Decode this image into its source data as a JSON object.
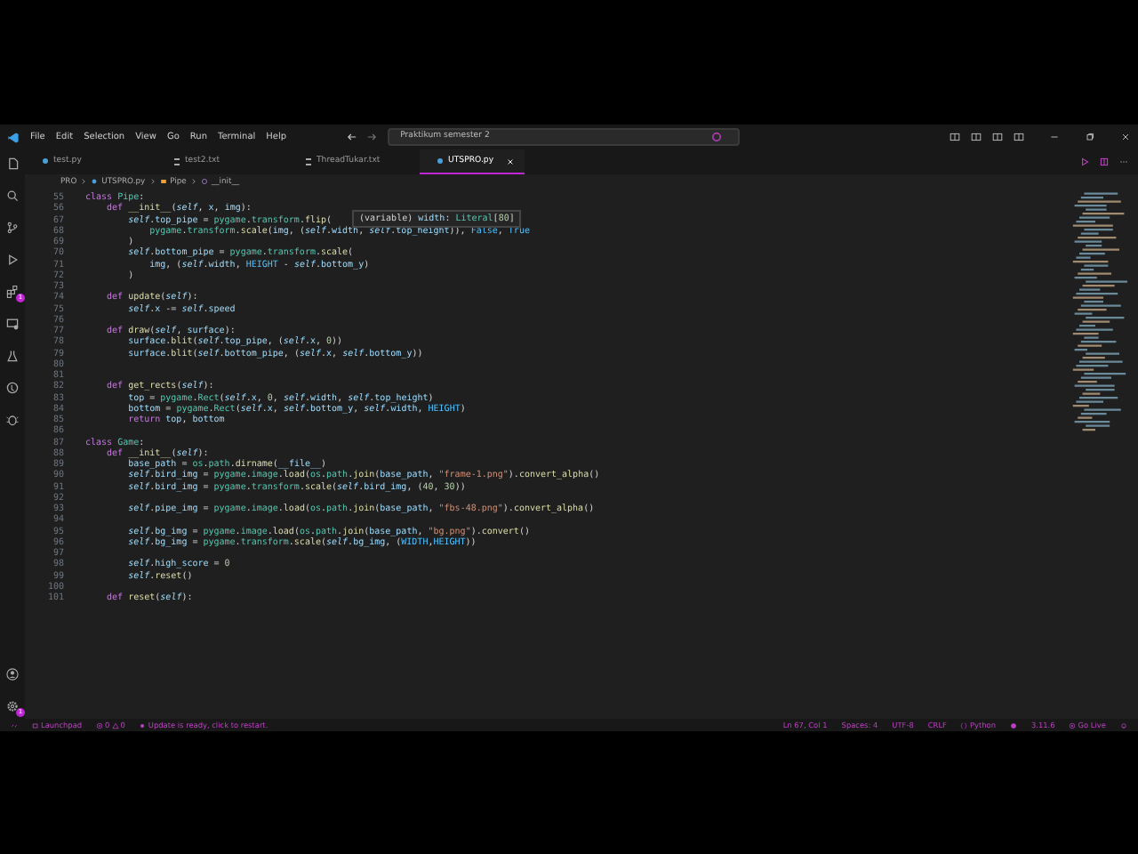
{
  "title_bar": {
    "menu": [
      "File",
      "Edit",
      "Selection",
      "View",
      "Go",
      "Run",
      "Terminal",
      "Help"
    ],
    "search": "Praktikum semester 2"
  },
  "activity_bar": {
    "extensions_badge": "1",
    "settings_badge": "1"
  },
  "tabs": [
    {
      "label": "test.py",
      "kind": "python",
      "selected": false
    },
    {
      "label": "test2.txt",
      "kind": "text",
      "selected": false
    },
    {
      "label": "ThreadTukar.txt",
      "kind": "text",
      "selected": false
    },
    {
      "label": "UTSPRO.py",
      "kind": "python",
      "selected": true
    }
  ],
  "breadcrumb": [
    {
      "label": "PRO",
      "kind": "folder"
    },
    {
      "label": "UTSPRO.py",
      "kind": "python"
    },
    {
      "label": "Pipe",
      "kind": "class"
    },
    {
      "label": "__init__",
      "kind": "method"
    }
  ],
  "editor": {
    "lines": [
      {
        "number": "55",
        "parts": [
          {
            "kind": "keyword",
            "text": "class "
          },
          {
            "kind": "type",
            "text": "Pipe"
          },
          {
            "kind": "plain",
            "text": ":"
          }
        ]
      },
      {
        "number": "56",
        "parts": [
          {
            "kind": "keyword",
            "text": "    def "
          },
          {
            "kind": "function",
            "text": "__init__"
          },
          {
            "kind": "plain",
            "text": "("
          },
          {
            "kind": "self",
            "text": "self"
          },
          {
            "kind": "plain",
            "text": ", "
          },
          {
            "kind": "name",
            "text": "x"
          },
          {
            "kind": "plain",
            "text": ", "
          },
          {
            "kind": "name",
            "text": "img"
          },
          {
            "kind": "plain",
            "text": "):"
          }
        ]
      },
      {
        "number": "67",
        "parts": [
          {
            "kind": "self",
            "text": "        self"
          },
          {
            "kind": "plain",
            "text": "."
          },
          {
            "kind": "name",
            "text": "top_pipe"
          },
          {
            "kind": "plain",
            "text": " = "
          },
          {
            "kind": "type",
            "text": "pygame"
          },
          {
            "kind": "plain",
            "text": "."
          },
          {
            "kind": "type",
            "text": "transform"
          },
          {
            "kind": "plain",
            "text": "."
          },
          {
            "kind": "function",
            "text": "flip"
          },
          {
            "kind": "plain",
            "text": "("
          }
        ]
      },
      {
        "number": "68",
        "parts": [
          {
            "kind": "type",
            "text": "            pygame"
          },
          {
            "kind": "plain",
            "text": "."
          },
          {
            "kind": "type",
            "text": "transform"
          },
          {
            "kind": "plain",
            "text": "."
          },
          {
            "kind": "function",
            "text": "scale"
          },
          {
            "kind": "plain",
            "text": "("
          },
          {
            "kind": "name",
            "text": "img"
          },
          {
            "kind": "plain",
            "text": ", ("
          },
          {
            "kind": "self",
            "text": "self"
          },
          {
            "kind": "plain",
            "text": "."
          },
          {
            "kind": "name",
            "text": "width"
          },
          {
            "kind": "plain",
            "text": ", "
          },
          {
            "kind": "self",
            "text": "self"
          },
          {
            "kind": "plain",
            "text": "."
          },
          {
            "kind": "name",
            "text": "top_height"
          },
          {
            "kind": "plain",
            "text": ")), "
          },
          {
            "kind": "constant",
            "text": "False"
          },
          {
            "kind": "plain",
            "text": ", "
          },
          {
            "kind": "constant",
            "text": "True"
          }
        ]
      },
      {
        "number": "69",
        "parts": [
          {
            "kind": "plain",
            "text": "        )"
          }
        ]
      },
      {
        "number": "70",
        "parts": [
          {
            "kind": "self",
            "text": "        self"
          },
          {
            "kind": "plain",
            "text": "."
          },
          {
            "kind": "name",
            "text": "bottom_pipe"
          },
          {
            "kind": "plain",
            "text": " = "
          },
          {
            "kind": "type",
            "text": "pygame"
          },
          {
            "kind": "plain",
            "text": "."
          },
          {
            "kind": "type",
            "text": "transform"
          },
          {
            "kind": "plain",
            "text": "."
          },
          {
            "kind": "function",
            "text": "scale"
          },
          {
            "kind": "plain",
            "text": "("
          }
        ]
      },
      {
        "number": "71",
        "parts": [
          {
            "kind": "name",
            "text": "            img"
          },
          {
            "kind": "plain",
            "text": ", ("
          },
          {
            "kind": "self",
            "text": "self"
          },
          {
            "kind": "plain",
            "text": "."
          },
          {
            "kind": "name",
            "text": "width"
          },
          {
            "kind": "plain",
            "text": ", "
          },
          {
            "kind": "constant",
            "text": "HEIGHT"
          },
          {
            "kind": "plain",
            "text": " - "
          },
          {
            "kind": "self",
            "text": "self"
          },
          {
            "kind": "plain",
            "text": "."
          },
          {
            "kind": "name",
            "text": "bottom_y"
          },
          {
            "kind": "plain",
            "text": ")"
          }
        ]
      },
      {
        "number": "72",
        "parts": [
          {
            "kind": "plain",
            "text": "        )"
          }
        ]
      },
      {
        "number": "73"
      },
      {
        "number": "74",
        "parts": [
          {
            "kind": "keyword",
            "text": "    def "
          },
          {
            "kind": "function",
            "text": "update"
          },
          {
            "kind": "plain",
            "text": "("
          },
          {
            "kind": "self",
            "text": "self"
          },
          {
            "kind": "plain",
            "text": "):"
          }
        ]
      },
      {
        "number": "75",
        "parts": [
          {
            "kind": "self",
            "text": "        self"
          },
          {
            "kind": "plain",
            "text": "."
          },
          {
            "kind": "name",
            "text": "x"
          },
          {
            "kind": "plain",
            "text": " -= "
          },
          {
            "kind": "self",
            "text": "self"
          },
          {
            "kind": "plain",
            "text": "."
          },
          {
            "kind": "name",
            "text": "speed"
          }
        ]
      },
      {
        "number": "76"
      },
      {
        "number": "77",
        "parts": [
          {
            "kind": "keyword",
            "text": "    def "
          },
          {
            "kind": "function",
            "text": "draw"
          },
          {
            "kind": "plain",
            "text": "("
          },
          {
            "kind": "self",
            "text": "self"
          },
          {
            "kind": "plain",
            "text": ", "
          },
          {
            "kind": "name",
            "text": "surface"
          },
          {
            "kind": "plain",
            "text": "):"
          }
        ]
      },
      {
        "number": "78",
        "parts": [
          {
            "kind": "name",
            "text": "        surface"
          },
          {
            "kind": "plain",
            "text": "."
          },
          {
            "kind": "function",
            "text": "blit"
          },
          {
            "kind": "plain",
            "text": "("
          },
          {
            "kind": "self",
            "text": "self"
          },
          {
            "kind": "plain",
            "text": "."
          },
          {
            "kind": "name",
            "text": "top_pipe"
          },
          {
            "kind": "plain",
            "text": ", ("
          },
          {
            "kind": "self",
            "text": "self"
          },
          {
            "kind": "plain",
            "text": "."
          },
          {
            "kind": "name",
            "text": "x"
          },
          {
            "kind": "plain",
            "text": ", "
          },
          {
            "kind": "number",
            "text": "0"
          },
          {
            "kind": "plain",
            "text": "))"
          }
        ]
      },
      {
        "number": "79",
        "parts": [
          {
            "kind": "name",
            "text": "        surface"
          },
          {
            "kind": "plain",
            "text": "."
          },
          {
            "kind": "function",
            "text": "blit"
          },
          {
            "kind": "plain",
            "text": "("
          },
          {
            "kind": "self",
            "text": "self"
          },
          {
            "kind": "plain",
            "text": "."
          },
          {
            "kind": "name",
            "text": "bottom_pipe"
          },
          {
            "kind": "plain",
            "text": ", ("
          },
          {
            "kind": "self",
            "text": "self"
          },
          {
            "kind": "plain",
            "text": "."
          },
          {
            "kind": "name",
            "text": "x"
          },
          {
            "kind": "plain",
            "text": ", "
          },
          {
            "kind": "self",
            "text": "self"
          },
          {
            "kind": "plain",
            "text": "."
          },
          {
            "kind": "name",
            "text": "bottom_y"
          },
          {
            "kind": "plain",
            "text": "))"
          }
        ]
      },
      {
        "number": "80"
      },
      {
        "number": "81"
      },
      {
        "number": "82",
        "parts": [
          {
            "kind": "keyword",
            "text": "    def "
          },
          {
            "kind": "function",
            "text": "get_rects"
          },
          {
            "kind": "plain",
            "text": "("
          },
          {
            "kind": "self",
            "text": "self"
          },
          {
            "kind": "plain",
            "text": "):"
          }
        ]
      },
      {
        "number": "83",
        "parts": [
          {
            "kind": "name",
            "text": "        top"
          },
          {
            "kind": "plain",
            "text": " = "
          },
          {
            "kind": "type",
            "text": "pygame"
          },
          {
            "kind": "plain",
            "text": "."
          },
          {
            "kind": "type",
            "text": "Rect"
          },
          {
            "kind": "plain",
            "text": "("
          },
          {
            "kind": "self",
            "text": "self"
          },
          {
            "kind": "plain",
            "text": "."
          },
          {
            "kind": "name",
            "text": "x"
          },
          {
            "kind": "plain",
            "text": ", "
          },
          {
            "kind": "number",
            "text": "0"
          },
          {
            "kind": "plain",
            "text": ", "
          },
          {
            "kind": "self",
            "text": "self"
          },
          {
            "kind": "plain",
            "text": "."
          },
          {
            "kind": "name",
            "text": "width"
          },
          {
            "kind": "plain",
            "text": ", "
          },
          {
            "kind": "self",
            "text": "self"
          },
          {
            "kind": "plain",
            "text": "."
          },
          {
            "kind": "name",
            "text": "top_height"
          },
          {
            "kind": "plain",
            "text": ")"
          }
        ]
      },
      {
        "number": "84",
        "parts": [
          {
            "kind": "name",
            "text": "        bottom"
          },
          {
            "kind": "plain",
            "text": " = "
          },
          {
            "kind": "type",
            "text": "pygame"
          },
          {
            "kind": "plain",
            "text": "."
          },
          {
            "kind": "type",
            "text": "Rect"
          },
          {
            "kind": "plain",
            "text": "("
          },
          {
            "kind": "self",
            "text": "self"
          },
          {
            "kind": "plain",
            "text": "."
          },
          {
            "kind": "name",
            "text": "x"
          },
          {
            "kind": "plain",
            "text": ", "
          },
          {
            "kind": "self",
            "text": "self"
          },
          {
            "kind": "plain",
            "text": "."
          },
          {
            "kind": "name",
            "text": "bottom_y"
          },
          {
            "kind": "plain",
            "text": ", "
          },
          {
            "kind": "self",
            "text": "self"
          },
          {
            "kind": "plain",
            "text": "."
          },
          {
            "kind": "name",
            "text": "width"
          },
          {
            "kind": "plain",
            "text": ", "
          },
          {
            "kind": "constant",
            "text": "HEIGHT"
          },
          {
            "kind": "plain",
            "text": ")"
          }
        ]
      },
      {
        "number": "85",
        "parts": [
          {
            "kind": "keyword",
            "text": "        return "
          },
          {
            "kind": "name",
            "text": "top"
          },
          {
            "kind": "plain",
            "text": ", "
          },
          {
            "kind": "name",
            "text": "bottom"
          }
        ]
      },
      {
        "number": "86"
      },
      {
        "number": "87",
        "parts": [
          {
            "kind": "keyword",
            "text": "class "
          },
          {
            "kind": "type",
            "text": "Game"
          },
          {
            "kind": "plain",
            "text": ":"
          }
        ]
      },
      {
        "number": "88",
        "parts": [
          {
            "kind": "keyword",
            "text": "    def "
          },
          {
            "kind": "function",
            "text": "__init__"
          },
          {
            "kind": "plain",
            "text": "("
          },
          {
            "kind": "self",
            "text": "self"
          },
          {
            "kind": "plain",
            "text": "):"
          }
        ]
      },
      {
        "number": "89",
        "parts": [
          {
            "kind": "name",
            "text": "        base_path"
          },
          {
            "kind": "plain",
            "text": " = "
          },
          {
            "kind": "type",
            "text": "os"
          },
          {
            "kind": "plain",
            "text": "."
          },
          {
            "kind": "type",
            "text": "path"
          },
          {
            "kind": "plain",
            "text": "."
          },
          {
            "kind": "function",
            "text": "dirname"
          },
          {
            "kind": "plain",
            "text": "("
          },
          {
            "kind": "name",
            "text": "__file__"
          },
          {
            "kind": "plain",
            "text": ")"
          }
        ]
      },
      {
        "number": "90",
        "parts": [
          {
            "kind": "self",
            "text": "        self"
          },
          {
            "kind": "plain",
            "text": "."
          },
          {
            "kind": "name",
            "text": "bird_img"
          },
          {
            "kind": "plain",
            "text": " = "
          },
          {
            "kind": "type",
            "text": "pygame"
          },
          {
            "kind": "plain",
            "text": "."
          },
          {
            "kind": "type",
            "text": "image"
          },
          {
            "kind": "plain",
            "text": "."
          },
          {
            "kind": "function",
            "text": "load"
          },
          {
            "kind": "plain",
            "text": "("
          },
          {
            "kind": "type",
            "text": "os"
          },
          {
            "kind": "plain",
            "text": "."
          },
          {
            "kind": "type",
            "text": "path"
          },
          {
            "kind": "plain",
            "text": "."
          },
          {
            "kind": "function",
            "text": "join"
          },
          {
            "kind": "plain",
            "text": "("
          },
          {
            "kind": "name",
            "text": "base_path"
          },
          {
            "kind": "plain",
            "text": ", "
          },
          {
            "kind": "string",
            "text": "\"frame-1.png\""
          },
          {
            "kind": "plain",
            "text": ")."
          },
          {
            "kind": "function",
            "text": "convert_alpha"
          },
          {
            "kind": "plain",
            "text": "()"
          }
        ]
      },
      {
        "number": "91",
        "parts": [
          {
            "kind": "self",
            "text": "        self"
          },
          {
            "kind": "plain",
            "text": "."
          },
          {
            "kind": "name",
            "text": "bird_img"
          },
          {
            "kind": "plain",
            "text": " = "
          },
          {
            "kind": "type",
            "text": "pygame"
          },
          {
            "kind": "plain",
            "text": "."
          },
          {
            "kind": "type",
            "text": "transform"
          },
          {
            "kind": "plain",
            "text": "."
          },
          {
            "kind": "function",
            "text": "scale"
          },
          {
            "kind": "plain",
            "text": "("
          },
          {
            "kind": "self",
            "text": "self"
          },
          {
            "kind": "plain",
            "text": "."
          },
          {
            "kind": "name",
            "text": "bird_img"
          },
          {
            "kind": "plain",
            "text": ", ("
          },
          {
            "kind": "number",
            "text": "40"
          },
          {
            "kind": "plain",
            "text": ", "
          },
          {
            "kind": "number",
            "text": "30"
          },
          {
            "kind": "plain",
            "text": "))"
          }
        ]
      },
      {
        "number": "92"
      },
      {
        "number": "93",
        "parts": [
          {
            "kind": "self",
            "text": "        self"
          },
          {
            "kind": "plain",
            "text": "."
          },
          {
            "kind": "name",
            "text": "pipe_img"
          },
          {
            "kind": "plain",
            "text": " = "
          },
          {
            "kind": "type",
            "text": "pygame"
          },
          {
            "kind": "plain",
            "text": "."
          },
          {
            "kind": "type",
            "text": "image"
          },
          {
            "kind": "plain",
            "text": "."
          },
          {
            "kind": "function",
            "text": "load"
          },
          {
            "kind": "plain",
            "text": "("
          },
          {
            "kind": "type",
            "text": "os"
          },
          {
            "kind": "plain",
            "text": "."
          },
          {
            "kind": "type",
            "text": "path"
          },
          {
            "kind": "plain",
            "text": "."
          },
          {
            "kind": "function",
            "text": "join"
          },
          {
            "kind": "plain",
            "text": "("
          },
          {
            "kind": "name",
            "text": "base_path"
          },
          {
            "kind": "plain",
            "text": ", "
          },
          {
            "kind": "string",
            "text": "\"fbs-48.png\""
          },
          {
            "kind": "plain",
            "text": ")."
          },
          {
            "kind": "function",
            "text": "convert_alpha"
          },
          {
            "kind": "plain",
            "text": "()"
          }
        ]
      },
      {
        "number": "94"
      },
      {
        "number": "95",
        "parts": [
          {
            "kind": "self",
            "text": "        self"
          },
          {
            "kind": "plain",
            "text": "."
          },
          {
            "kind": "name",
            "text": "bg_img"
          },
          {
            "kind": "plain",
            "text": " = "
          },
          {
            "kind": "type",
            "text": "pygame"
          },
          {
            "kind": "plain",
            "text": "."
          },
          {
            "kind": "type",
            "text": "image"
          },
          {
            "kind": "plain",
            "text": "."
          },
          {
            "kind": "function",
            "text": "load"
          },
          {
            "kind": "plain",
            "text": "("
          },
          {
            "kind": "type",
            "text": "os"
          },
          {
            "kind": "plain",
            "text": "."
          },
          {
            "kind": "type",
            "text": "path"
          },
          {
            "kind": "plain",
            "text": "."
          },
          {
            "kind": "function",
            "text": "join"
          },
          {
            "kind": "plain",
            "text": "("
          },
          {
            "kind": "name",
            "text": "base_path"
          },
          {
            "kind": "plain",
            "text": ", "
          },
          {
            "kind": "string",
            "text": "\"bg.png\""
          },
          {
            "kind": "plain",
            "text": ")."
          },
          {
            "kind": "function",
            "text": "convert"
          },
          {
            "kind": "plain",
            "text": "()"
          }
        ]
      },
      {
        "number": "96",
        "parts": [
          {
            "kind": "self",
            "text": "        self"
          },
          {
            "kind": "plain",
            "text": "."
          },
          {
            "kind": "name",
            "text": "bg_img"
          },
          {
            "kind": "plain",
            "text": " = "
          },
          {
            "kind": "type",
            "text": "pygame"
          },
          {
            "kind": "plain",
            "text": "."
          },
          {
            "kind": "type",
            "text": "transform"
          },
          {
            "kind": "plain",
            "text": "."
          },
          {
            "kind": "function",
            "text": "scale"
          },
          {
            "kind": "plain",
            "text": "("
          },
          {
            "kind": "self",
            "text": "self"
          },
          {
            "kind": "plain",
            "text": "."
          },
          {
            "kind": "name",
            "text": "bg_img"
          },
          {
            "kind": "plain",
            "text": ", ("
          },
          {
            "kind": "constant",
            "text": "WIDTH"
          },
          {
            "kind": "plain",
            "text": ","
          },
          {
            "kind": "constant",
            "text": "HEIGHT"
          },
          {
            "kind": "plain",
            "text": "))"
          }
        ]
      },
      {
        "number": "97"
      },
      {
        "number": "98",
        "parts": [
          {
            "kind": "self",
            "text": "        self"
          },
          {
            "kind": "plain",
            "text": "."
          },
          {
            "kind": "name",
            "text": "high_score"
          },
          {
            "kind": "plain",
            "text": " = "
          },
          {
            "kind": "number",
            "text": "0"
          }
        ]
      },
      {
        "number": "99",
        "parts": [
          {
            "kind": "self",
            "text": "        self"
          },
          {
            "kind": "plain",
            "text": "."
          },
          {
            "kind": "function",
            "text": "reset"
          },
          {
            "kind": "plain",
            "text": "()"
          }
        ]
      },
      {
        "number": "100"
      },
      {
        "number": "101",
        "parts": [
          {
            "kind": "keyword",
            "text": "    def "
          },
          {
            "kind": "function",
            "text": "reset"
          },
          {
            "kind": "plain",
            "text": "("
          },
          {
            "kind": "self",
            "text": "self"
          },
          {
            "kind": "plain",
            "text": "):"
          }
        ]
      }
    ],
    "hover": [
      {
        "kind": "plain",
        "text": "(variable) "
      },
      {
        "kind": "name",
        "text": "width"
      },
      {
        "kind": "plain",
        "text": ": "
      },
      {
        "kind": "type",
        "text": "Literal"
      },
      {
        "kind": "plain",
        "text": "["
      },
      {
        "kind": "number",
        "text": "80"
      },
      {
        "kind": "plain",
        "text": "]"
      }
    ]
  },
  "status_bar": {
    "launchpad": "Launchpad",
    "errors": "0",
    "warnings": "0",
    "update": "Update is ready, click to restart.",
    "cursor": "Ln 67, Col 1",
    "indentation": "Spaces: 4",
    "encoding": "UTF-8",
    "line_endings": "CRLF",
    "language": "Python",
    "interpreter": "3.11.6",
    "live_server": "Go Live"
  }
}
